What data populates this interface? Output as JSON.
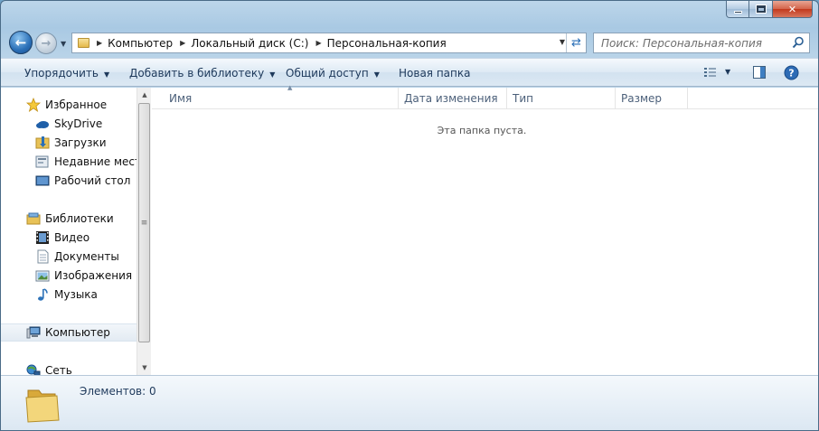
{
  "window": {
    "title": "",
    "buttons": {
      "min": "",
      "max": "",
      "close": "✕"
    }
  },
  "address": {
    "crumbs": [
      "Компьютер",
      "Локальный диск (C:)",
      "Персональная-копия"
    ]
  },
  "search": {
    "placeholder": "Поиск: Персональная-копия"
  },
  "toolbar": {
    "organize": "Упорядочить",
    "add_to_library": "Добавить в библиотеку",
    "share": "Общий доступ",
    "new_folder": "Новая папка"
  },
  "sidebar": {
    "favorites": {
      "label": "Избранное",
      "items": [
        "SkyDrive",
        "Загрузки",
        "Недавние места",
        "Рабочий стол"
      ]
    },
    "libraries": {
      "label": "Библиотеки",
      "items": [
        "Видео",
        "Документы",
        "Изображения",
        "Музыка"
      ]
    },
    "computer": "Компьютер",
    "network": "Сеть"
  },
  "columns": [
    "Имя",
    "Дата изменения",
    "Тип",
    "Размер"
  ],
  "empty_message": "Эта папка пуста.",
  "details": {
    "item_count": "Элементов: 0"
  },
  "colors": {
    "accent": "#1e395b",
    "selection": "#e3ebf3"
  }
}
